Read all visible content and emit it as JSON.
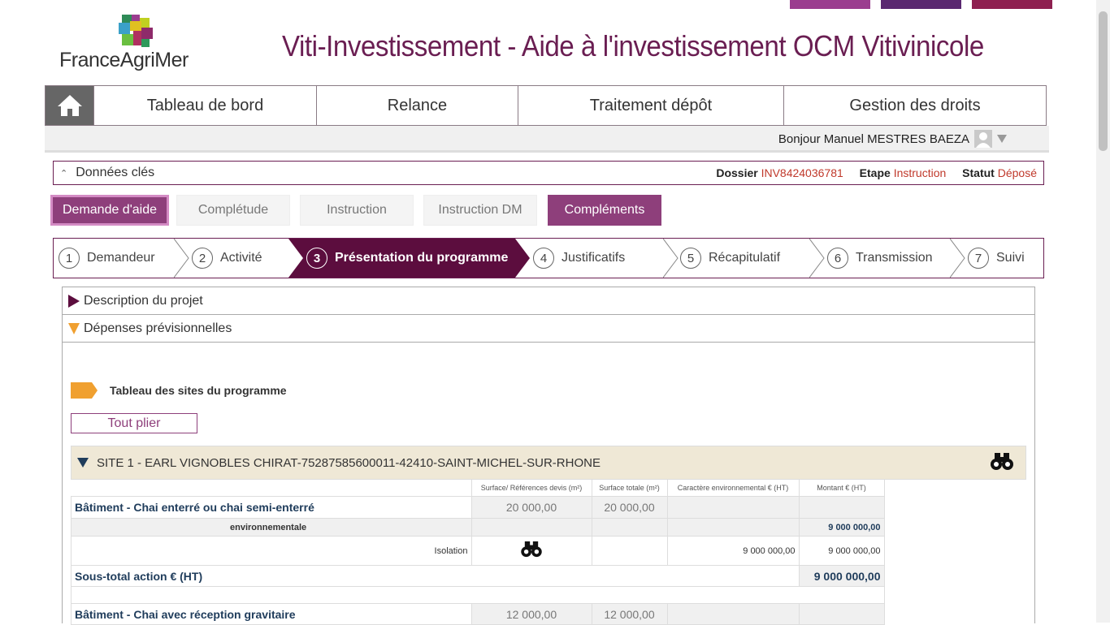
{
  "colors": {
    "brand": "#6a1e52",
    "accent": "#8e3f7b",
    "status": "#c0392b",
    "orange": "#f0a030"
  },
  "header": {
    "logo_text": "FranceAgriMer",
    "app_title": "Viti-Investissement - Aide à l'investissement OCM Vitivinicole"
  },
  "nav": {
    "home_icon": "home-icon",
    "items": [
      "Tableau de bord",
      "Relance",
      "Traitement dépôt",
      "Gestion des droits"
    ]
  },
  "user": {
    "greeting": "Bonjour Manuel MESTRES BAEZA"
  },
  "key_data": {
    "label": "Données clés",
    "dossier_label": "Dossier",
    "dossier_value": "INV8424036781",
    "etape_label": "Etape",
    "etape_value": "Instruction",
    "statut_label": "Statut",
    "statut_value": "Déposé"
  },
  "tabs": [
    "Demande d'aide",
    "Complétude",
    "Instruction",
    "Instruction DM",
    "Compléments"
  ],
  "steps": [
    {
      "num": "1",
      "label": "Demandeur"
    },
    {
      "num": "2",
      "label": "Activité"
    },
    {
      "num": "3",
      "label": "Présentation du programme"
    },
    {
      "num": "4",
      "label": "Justificatifs"
    },
    {
      "num": "5",
      "label": "Récapitulatif"
    },
    {
      "num": "6",
      "label": "Transmission"
    },
    {
      "num": "7",
      "label": "Suivi"
    }
  ],
  "accordion": {
    "description": "Description du projet",
    "depenses": "Dépenses prévisionnelles"
  },
  "section": {
    "title": "Tableau des sites du programme",
    "toggle_label": "Tout plier"
  },
  "site": {
    "title": "SITE 1 - EARL VIGNOBLES CHIRAT-75287585600011-42410-SAINT-MICHEL-SUR-RHONE"
  },
  "table": {
    "headers": [
      "Surface/ Références devis (m²)",
      "Surface totale (m²)",
      "Caractère environnemental € (HT)",
      "Montant € (HT)"
    ],
    "row1": {
      "label": "Bâtiment - Chai enterré ou chai semi-enterré",
      "surface": "20 000,00",
      "total": "20 000,00"
    },
    "row2": {
      "label": "environnementale",
      "montant": "9 000 000,00"
    },
    "row3": {
      "label": "Isolation",
      "env": "9 000 000,00",
      "montant": "9 000 000,00"
    },
    "subtotal": {
      "label": "Sous-total action € (HT)",
      "value": "9 000 000,00"
    },
    "row5": {
      "label": "Bâtiment - Chai avec réception gravitaire",
      "surface": "12 000,00",
      "total": "12 000,00"
    }
  }
}
